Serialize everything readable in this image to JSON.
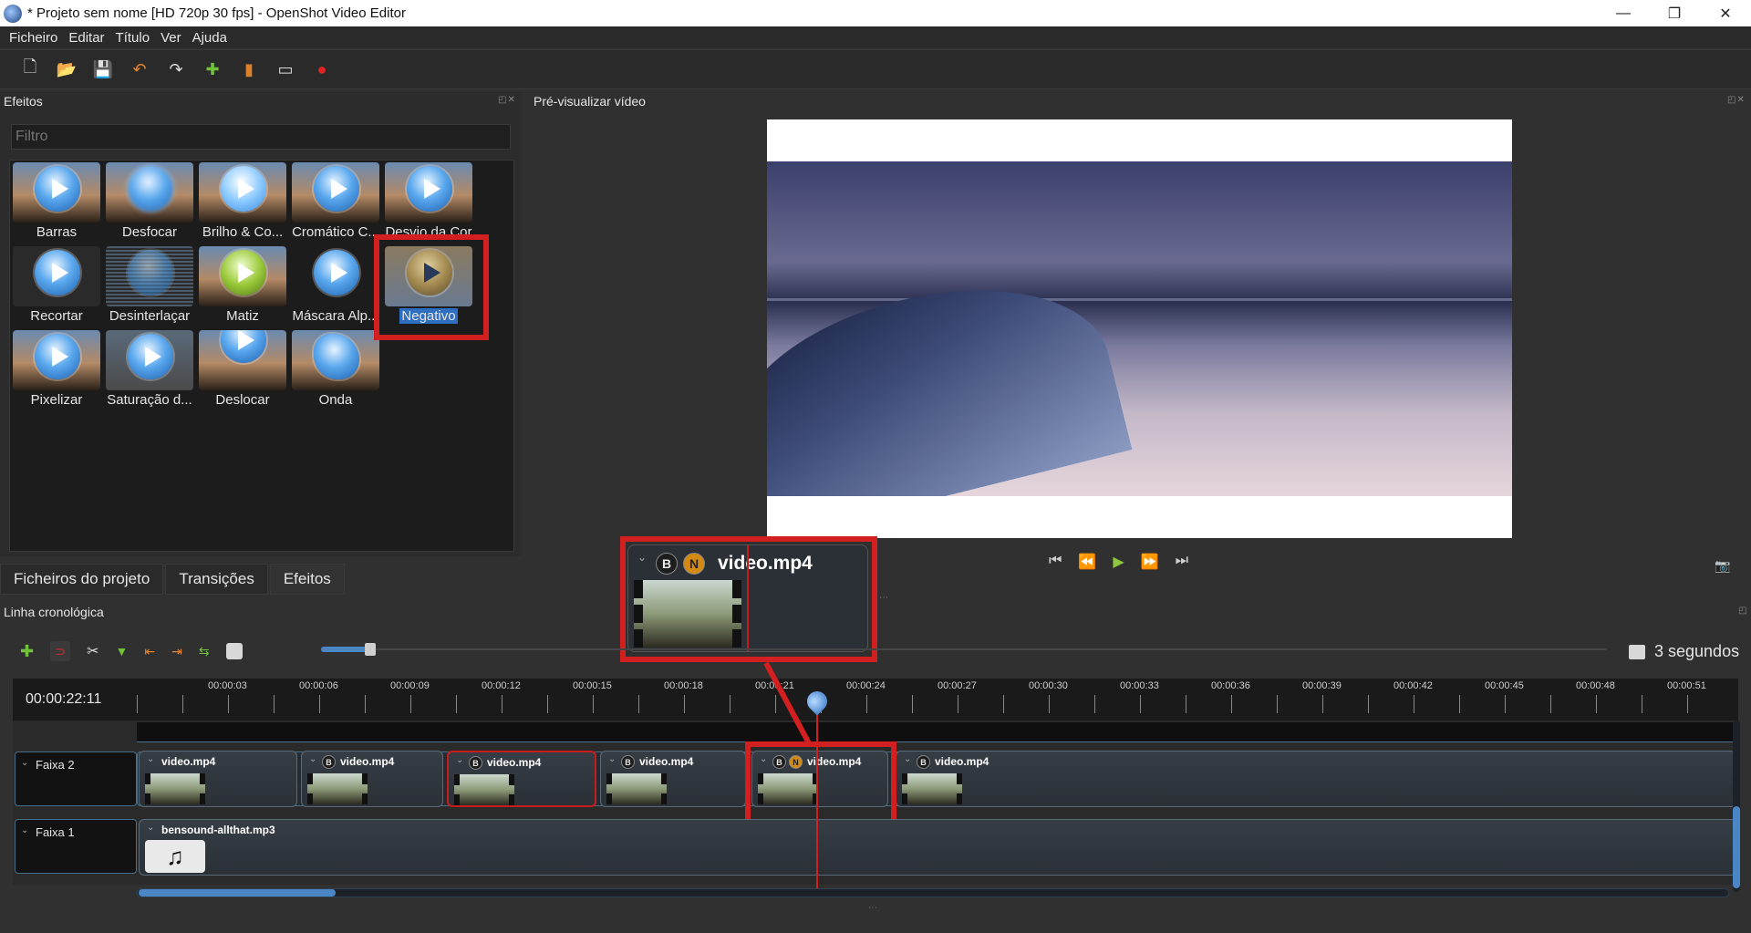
{
  "window": {
    "title": "* Projeto sem nome [HD 720p 30 fps] - OpenShot Video Editor",
    "minimize": "—",
    "restore": "❐",
    "close": "✕"
  },
  "menu": [
    "Ficheiro",
    "Editar",
    "Título",
    "Ver",
    "Ajuda"
  ],
  "effects_panel": {
    "title": "Efeitos",
    "filter_placeholder": "Filtro",
    "items": [
      {
        "label": "Barras"
      },
      {
        "label": "Desfocar"
      },
      {
        "label": "Brilho & Co..."
      },
      {
        "label": "Cromático C..."
      },
      {
        "label": "Desvio da Cor"
      },
      {
        "label": "Recortar"
      },
      {
        "label": "Desinterlaçar"
      },
      {
        "label": "Matiz"
      },
      {
        "label": "Máscara Alp..."
      },
      {
        "label": "Negativo"
      },
      {
        "label": "Pixelizar"
      },
      {
        "label": "Saturação d..."
      },
      {
        "label": "Deslocar"
      },
      {
        "label": "Onda"
      }
    ],
    "selected": "Negativo"
  },
  "tabs": [
    "Ficheiros do projeto",
    "Transições",
    "Efeitos"
  ],
  "active_tab": "Efeitos",
  "preview": {
    "title": "Pré-visualizar vídeo"
  },
  "drag_popup": {
    "clip_name": "video.mp4",
    "badge_b": "B",
    "badge_n": "N"
  },
  "timeline": {
    "title": "Linha cronológica",
    "timecode": "00:00:22:11",
    "zoom_label": "3 segundos",
    "ticks": [
      "00:00:03",
      "00:00:06",
      "00:00:09",
      "00:00:12",
      "00:00:15",
      "00:00:18",
      "00:00:21",
      "00:00:24",
      "00:00:27",
      "00:00:30",
      "00:00:33",
      "00:00:36",
      "00:00:39",
      "00:00:42",
      "00:00:45",
      "00:00:48",
      "00:00:51"
    ],
    "tracks": [
      {
        "name": "Faixa 2",
        "clips": [
          {
            "name": "video.mp4",
            "badges": []
          },
          {
            "name": "video.mp4",
            "badges": [
              "B"
            ]
          },
          {
            "name": "video.mp4",
            "badges": [
              "B"
            ],
            "selected": true
          },
          {
            "name": "video.mp4",
            "badges": [
              "B"
            ]
          },
          {
            "name": "video.mp4",
            "badges": [
              "B",
              "N"
            ]
          },
          {
            "name": "video.mp4",
            "badges": [
              "B"
            ]
          }
        ]
      },
      {
        "name": "Faixa 1",
        "clips": [
          {
            "name": "bensound-allthat.mp3"
          }
        ]
      }
    ]
  },
  "colors": {
    "accent": "#4a86c4",
    "highlight_red": "#d21f1f",
    "selection_blue": "#2e6fc2"
  }
}
